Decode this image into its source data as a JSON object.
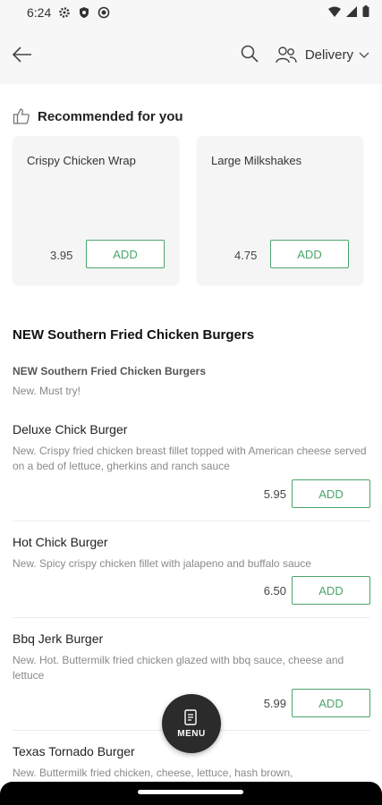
{
  "status_bar": {
    "time": "6:24"
  },
  "header": {
    "delivery_label": "Delivery"
  },
  "recommended": {
    "title": "Recommended for you",
    "items": [
      {
        "name": "Crispy Chicken Wrap",
        "price": "3.95",
        "add_label": "ADD"
      },
      {
        "name": "Large Milkshakes",
        "price": "4.75",
        "add_label": "ADD"
      }
    ]
  },
  "section": {
    "title": "NEW Southern Fried Chicken Burgers",
    "subtitle": "NEW Southern Fried Chicken Burgers",
    "description": "New. Must try!"
  },
  "items": [
    {
      "name": "Deluxe Chick Burger",
      "description": "New. Crispy fried chicken breast fillet topped with American cheese served on a bed of lettuce, gherkins and ranch sauce",
      "price": "5.95",
      "add_label": "ADD"
    },
    {
      "name": "Hot Chick Burger",
      "description": "New. Spicy crispy chicken fillet with jalapeno and buffalo sauce",
      "price": "6.50",
      "add_label": "ADD"
    },
    {
      "name": "Bbq Jerk Burger",
      "description": "New. Hot. Buttermilk fried chicken glazed with bbq sauce, cheese and lettuce",
      "price": "5.99",
      "add_label": "ADD"
    },
    {
      "name": "Texas Tornado Burger",
      "description": "New. Buttermilk fried chicken, cheese, lettuce, hash brown,"
    }
  ],
  "menu_button": {
    "label": "MENU"
  },
  "colors": {
    "accent": "#4aa56a",
    "fab": "#2b2b2b"
  }
}
